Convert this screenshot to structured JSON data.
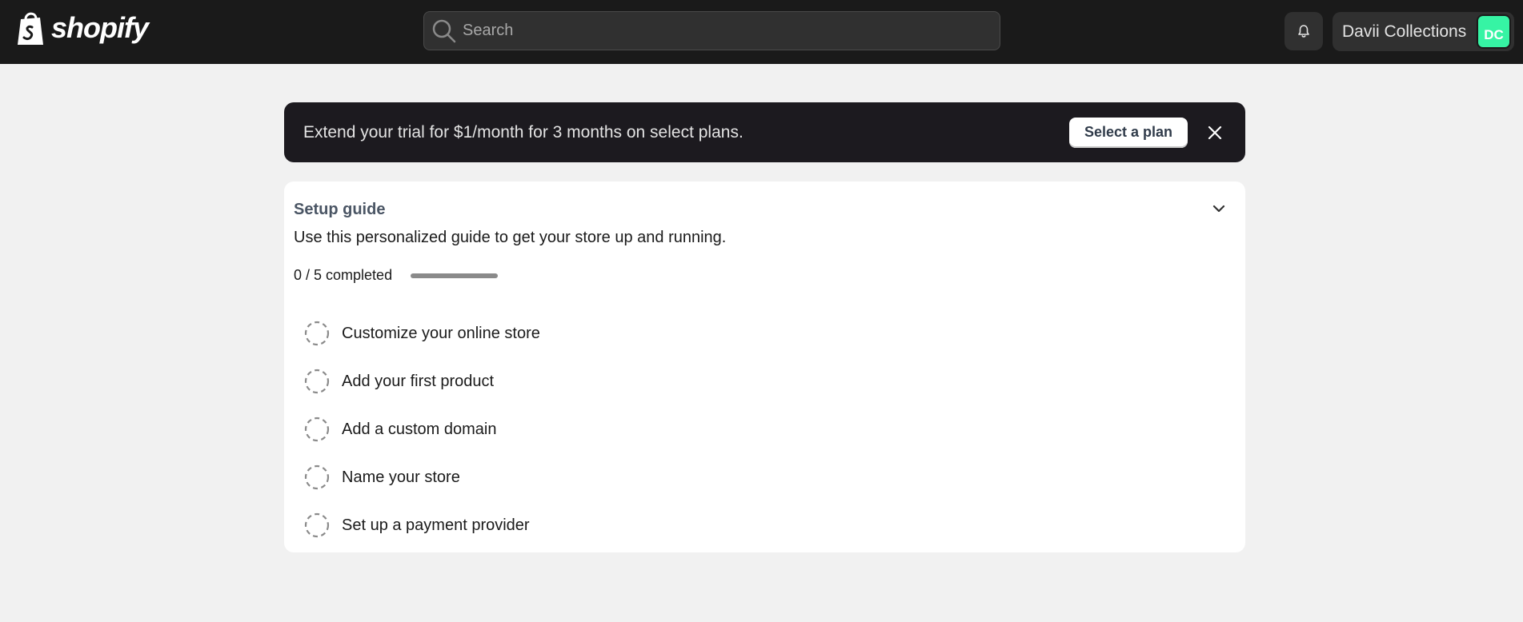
{
  "topbar": {
    "logo_text": "shopify",
    "search": {
      "placeholder": "Search",
      "value": ""
    },
    "store_name": "Davii Collections",
    "avatar_initials": "DC"
  },
  "banner": {
    "text": "Extend your trial for $1/month for 3 months on select plans.",
    "button_label": "Select a plan"
  },
  "setup_guide": {
    "title": "Setup guide",
    "description": "Use this personalized guide to get your store up and running.",
    "progress_label": "0 / 5 completed",
    "completed": 0,
    "total": 5,
    "tasks": [
      {
        "label": "Customize your online store"
      },
      {
        "label": "Add your first product"
      },
      {
        "label": "Add a custom domain"
      },
      {
        "label": "Name your store"
      },
      {
        "label": "Set up a payment provider"
      }
    ]
  },
  "colors": {
    "topbar_bg": "#1a1a1a",
    "avatar_bg": "#36f4a4",
    "banner_bg": "#1c1a1f",
    "page_bg": "#f1f1f1"
  },
  "icons": [
    "shopify-bag-icon",
    "search-icon",
    "bell-icon",
    "close-icon",
    "chevron-down-icon",
    "dashed-circle-icon"
  ]
}
